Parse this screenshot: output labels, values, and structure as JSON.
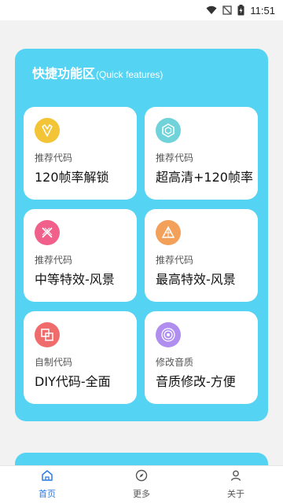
{
  "status_bar": {
    "time": "11:51",
    "icons": [
      "wifi-icon",
      "no-signal-icon",
      "battery-charging-icon"
    ]
  },
  "panel": {
    "title_cn": "快捷功能区",
    "title_en": "(Quick features)",
    "cards": [
      {
        "label": "推荐代码",
        "title": "120帧率解锁",
        "icon": "crystal-icon",
        "color": "#f2c436"
      },
      {
        "label": "推荐代码",
        "title": "超高清+120帧率",
        "icon": "hexagon-icon",
        "color": "#6fd3d9"
      },
      {
        "label": "推荐代码",
        "title": "中等特效-风景",
        "icon": "cross-lines-icon",
        "color": "#f0608a"
      },
      {
        "label": "推荐代码",
        "title": "最高特效-风景",
        "icon": "triangle-icon",
        "color": "#f2a05a"
      },
      {
        "label": "自制代码",
        "title": "DIY代码-全面",
        "icon": "layers-icon",
        "color": "#f06b6b"
      },
      {
        "label": "修改音质",
        "title": "音质修改-方便",
        "icon": "rings-icon",
        "color": "#b08ef0"
      }
    ]
  },
  "nav": {
    "items": [
      {
        "label": "首页",
        "icon": "home-icon",
        "active": true
      },
      {
        "label": "更多",
        "icon": "compass-icon",
        "active": false
      },
      {
        "label": "关于",
        "icon": "person-icon",
        "active": false
      }
    ]
  }
}
